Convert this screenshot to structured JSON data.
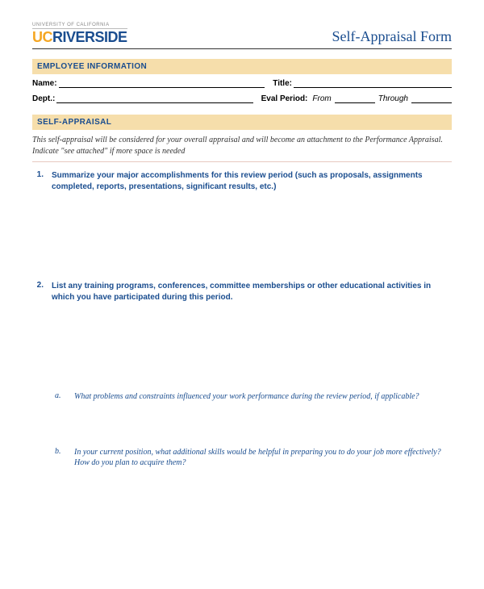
{
  "logo": {
    "top": "UNIVERSITY OF CALIFORNIA",
    "uc": "UC",
    "riv": "RIVERSIDE"
  },
  "form_title": "Self-Appraisal Form",
  "sections": {
    "employee_info": "EMPLOYEE INFORMATION",
    "self_appraisal": "SELF-APPRAISAL"
  },
  "fields": {
    "name": "Name:",
    "title": "Title:",
    "dept": "Dept.:",
    "eval_period": "Eval Period:",
    "from": "From",
    "through": "Through"
  },
  "note": "This self-appraisal will be considered for your overall appraisal and will become an attachment to the Performance Appraisal. Indicate \"see attached\" if more space is needed",
  "questions": {
    "q1_num": "1.",
    "q1": "Summarize your major accomplishments for this review period (such as proposals, assignments completed, reports, presentations, significant results, etc.)",
    "q2_num": "2.",
    "q2": "List any training programs, conferences, committee memberships or other educational activities in which you have participated during this period.",
    "qa_num": "a.",
    "qa": "What problems and constraints influenced your work performance during the review period, if applicable?",
    "qb_num": "b.",
    "qb": "In your current position, what additional skills would be helpful in preparing you to do your job more effectively? How do you plan to acquire them?"
  }
}
